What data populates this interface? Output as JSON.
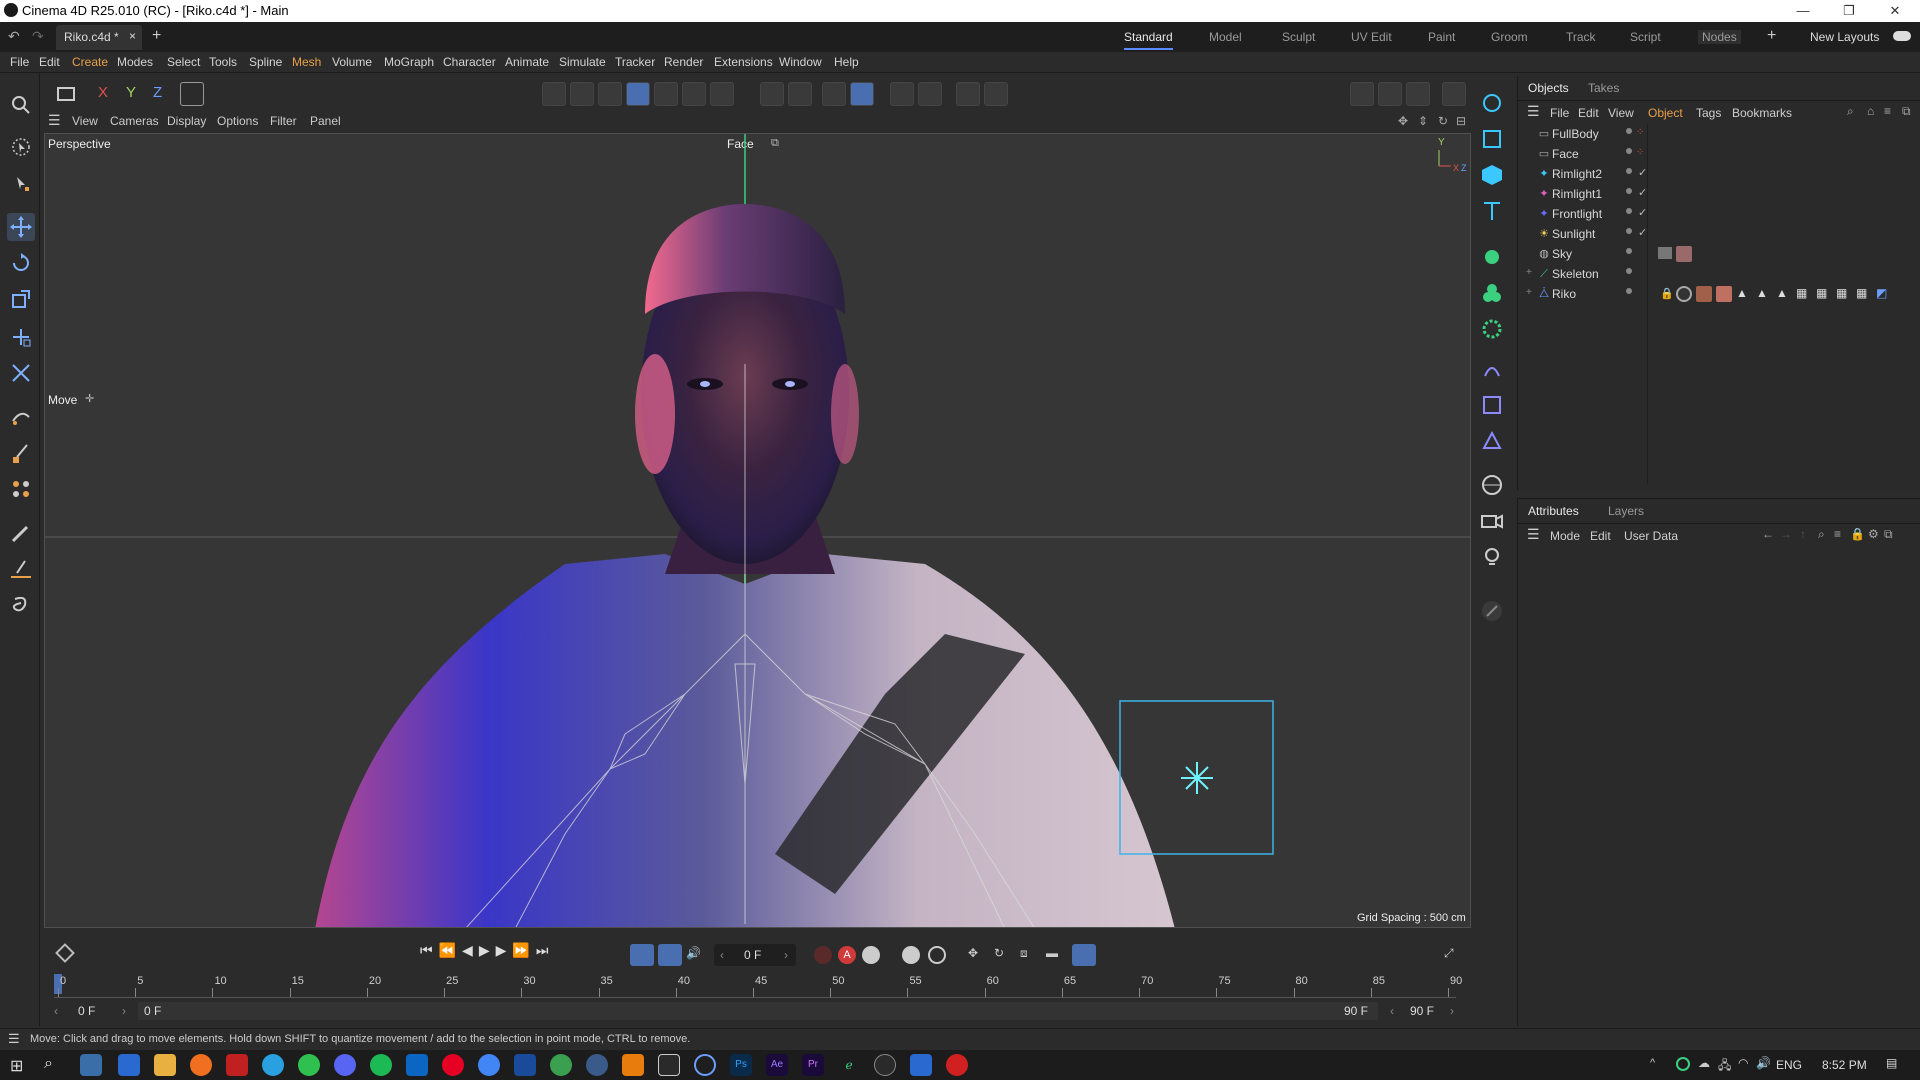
{
  "window": {
    "title": "Cinema 4D R25.010 (RC) - [Riko.c4d *] - Main"
  },
  "doc_tab": {
    "label": "Riko.c4d *",
    "close": "×",
    "add": "+"
  },
  "layouts": [
    "Standard",
    "Model",
    "Sculpt",
    "UV Edit",
    "Paint",
    "Groom",
    "Track",
    "Script",
    "Nodes"
  ],
  "new_layouts": "New Layouts",
  "menu": [
    "File",
    "Edit",
    "Create",
    "Modes",
    "Select",
    "Tools",
    "Spline",
    "Mesh",
    "Volume",
    "MoGraph",
    "Character",
    "Animate",
    "Simulate",
    "Tracker",
    "Render",
    "Extensions",
    "Window",
    "Help"
  ],
  "axes": [
    "X",
    "Y",
    "Z"
  ],
  "viewport_menu": [
    "View",
    "Cameras",
    "Display",
    "Options",
    "Filter",
    "Panel"
  ],
  "viewport": {
    "camera_name": "Perspective",
    "face_label": "Face",
    "tool_label": "Move",
    "grid_spacing": "Grid Spacing : 500 cm",
    "axis_y": "Y",
    "axis_x": "X",
    "axis_z": "Z"
  },
  "objects_panel": {
    "tabs": [
      "Objects",
      "Takes"
    ],
    "menu": [
      "File",
      "Edit",
      "View",
      "Object",
      "Tags",
      "Bookmarks"
    ],
    "items": [
      {
        "name": "FullBody",
        "icon": "camera-icon"
      },
      {
        "name": "Face",
        "icon": "camera-icon"
      },
      {
        "name": "Rimlight2",
        "icon": "light-icon"
      },
      {
        "name": "Rimlight1",
        "icon": "light-icon"
      },
      {
        "name": "Frontlight",
        "icon": "light-icon"
      },
      {
        "name": "Sunlight",
        "icon": "sun-icon"
      },
      {
        "name": "Sky",
        "icon": "sky-icon"
      },
      {
        "name": "Skeleton",
        "icon": "joint-icon"
      },
      {
        "name": "Riko",
        "icon": "character-icon"
      }
    ]
  },
  "attributes_panel": {
    "tabs": [
      "Attributes",
      "Layers"
    ],
    "menu": [
      "Mode",
      "Edit",
      "User Data"
    ]
  },
  "timeline": {
    "current_frame": "0 F",
    "ticks": [
      "0",
      "5",
      "10",
      "15",
      "20",
      "25",
      "30",
      "35",
      "40",
      "45",
      "50",
      "55",
      "60",
      "65",
      "70",
      "75",
      "80",
      "85",
      "90"
    ],
    "start": "0 F",
    "range_start": "0 F",
    "range_end": "90 F",
    "end": "90 F"
  },
  "status": "Move: Click and drag to move elements. Hold down SHIFT to quantize movement / add to the selection in point mode, CTRL to remove.",
  "taskbar": {
    "lang": "ENG",
    "time": "8:52 PM"
  }
}
